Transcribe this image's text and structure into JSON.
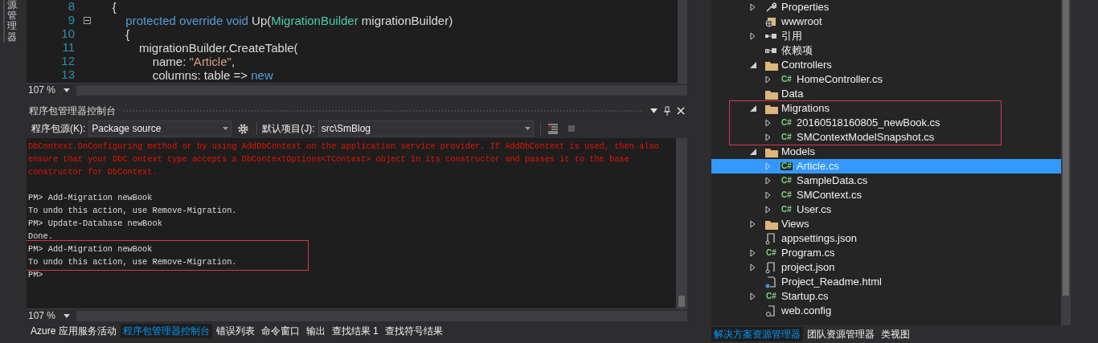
{
  "left_strip": {
    "label": "源管理器"
  },
  "editor": {
    "lines": [
      {
        "number": "8",
        "tokens": [
          {
            "text": "    {",
            "kind": "plain"
          }
        ]
      },
      {
        "number": "9",
        "collapsible": true,
        "tokens": [
          {
            "text": "        protected override void ",
            "kind": "keyword"
          },
          {
            "text": "Up(",
            "kind": "plain"
          },
          {
            "text": "MigrationBuilder",
            "kind": "type"
          },
          {
            "text": " migrationBuilder)",
            "kind": "plain"
          }
        ]
      },
      {
        "number": "10",
        "tokens": [
          {
            "text": "        {",
            "kind": "plain"
          }
        ]
      },
      {
        "number": "11",
        "tokens": [
          {
            "text": "            migrationBuilder.CreateTable(",
            "kind": "plain"
          }
        ]
      },
      {
        "number": "12",
        "tokens": [
          {
            "text": "                name: ",
            "kind": "plain"
          },
          {
            "text": "\"Article\"",
            "kind": "string"
          },
          {
            "text": ",",
            "kind": "plain"
          }
        ]
      },
      {
        "number": "13",
        "tokens": [
          {
            "text": "                columns: table => ",
            "kind": "plain"
          },
          {
            "text": "new",
            "kind": "keyword"
          }
        ]
      }
    ],
    "zoom": "107 %"
  },
  "console": {
    "title": "程序包管理器控制台",
    "source_label": "程序包源(K):",
    "source_value": "Package source",
    "project_label": "默认项目(J):",
    "project_value": "src\\SmBlog",
    "lines": [
      {
        "kind": "error",
        "text": "DbContext.OnConfiguring method or by using AddDbContext on the application service provider. If AddDbContext is used, then also",
        "highlighted": false
      },
      {
        "kind": "error",
        "text": "ensure that your DbC ontext type accepts a DbContextOptions<TContext> object in its constructor and passes it to the base",
        "highlighted": false
      },
      {
        "kind": "error",
        "text": "constructor for DbContext.",
        "highlighted": false
      },
      {
        "kind": "blank",
        "highlighted": false
      },
      {
        "kind": "output",
        "text": "PM> Add-Migration newBook",
        "highlighted": false
      },
      {
        "kind": "output",
        "text": "To undo this action, use Remove-Migration.",
        "highlighted": false
      },
      {
        "kind": "output",
        "text": "PM> Update-Database newBook",
        "highlighted": false
      },
      {
        "kind": "output",
        "text": "Done.",
        "highlighted": false
      },
      {
        "kind": "output",
        "text": "PM> Add-Migration newBook",
        "highlighted": true
      },
      {
        "kind": "output",
        "text": "To undo this action, use Remove-Migration.",
        "highlighted": true
      },
      {
        "kind": "output",
        "text": "PM>",
        "highlighted": false
      }
    ],
    "zoom": "107 %"
  },
  "bottom_tabs": [
    {
      "label": "Azure 应用服务活动",
      "selected": false
    },
    {
      "label": "程序包管理器控制台",
      "selected": true
    },
    {
      "label": "错误列表",
      "selected": false
    },
    {
      "label": "命令窗口",
      "selected": false
    },
    {
      "label": "输出",
      "selected": false
    },
    {
      "label": "查找结果 1",
      "selected": false
    },
    {
      "label": "查找符号结果",
      "selected": false
    }
  ],
  "solution_tree": {
    "items": [
      {
        "label": "Properties",
        "kind": "wrench",
        "expanded": false,
        "selected": false
      },
      {
        "label": "wwwroot",
        "kind": "web",
        "selected": false
      },
      {
        "label": "引用",
        "kind": "reference",
        "expanded": false,
        "selected": false
      },
      {
        "label": "依赖项",
        "kind": "dependency",
        "selected": false
      },
      {
        "label": "Controllers",
        "kind": "folder",
        "expanded": true,
        "selected": false,
        "children": [
          {
            "label": "HomeController.cs",
            "kind": "cs",
            "icon_text": "C#",
            "expanded": false,
            "selected": false
          }
        ]
      },
      {
        "label": "Data",
        "kind": "folder",
        "selected": false
      },
      {
        "label": "Migrations",
        "kind": "folder",
        "expanded": true,
        "selected": false,
        "highlighted": true,
        "children": [
          {
            "label": "20160518160805_newBook.cs",
            "kind": "cs",
            "icon_text": "C#",
            "expanded": false,
            "selected": false
          },
          {
            "label": "SMContextModelSnapshot.cs",
            "kind": "cs",
            "icon_text": "C#",
            "expanded": false,
            "selected": false
          }
        ]
      },
      {
        "label": "Models",
        "kind": "folder",
        "expanded": true,
        "selected": false,
        "children": [
          {
            "label": "Article.cs",
            "kind": "cs",
            "icon_text": "C#",
            "expanded": false,
            "selected": true
          },
          {
            "label": "SampleData.cs",
            "kind": "cs",
            "icon_text": "C#",
            "expanded": false,
            "selected": false
          },
          {
            "label": "SMContext.cs",
            "kind": "cs",
            "icon_text": "C#",
            "expanded": false,
            "selected": false
          },
          {
            "label": "User.cs",
            "kind": "cs",
            "icon_text": "C#",
            "expanded": false,
            "selected": false
          }
        ]
      },
      {
        "label": "Views",
        "kind": "folder",
        "expanded": false,
        "selected": false
      },
      {
        "label": "appsettings.json",
        "kind": "json",
        "selected": false
      },
      {
        "label": "Program.cs",
        "kind": "cs",
        "icon_text": "C#",
        "expanded": false,
        "selected": false
      },
      {
        "label": "project.json",
        "kind": "json",
        "expanded": false,
        "selected": false
      },
      {
        "label": "Project_Readme.html",
        "kind": "html",
        "selected": false
      },
      {
        "label": "Startup.cs",
        "kind": "cs",
        "icon_text": "C#",
        "expanded": false,
        "selected": false
      },
      {
        "label": "web.config",
        "kind": "config",
        "selected": false
      }
    ]
  },
  "right_tabs": [
    {
      "label": "解决方案资源管理器",
      "selected": true
    },
    {
      "label": "团队资源管理器",
      "selected": false
    },
    {
      "label": "类视图",
      "selected": false
    }
  ]
}
